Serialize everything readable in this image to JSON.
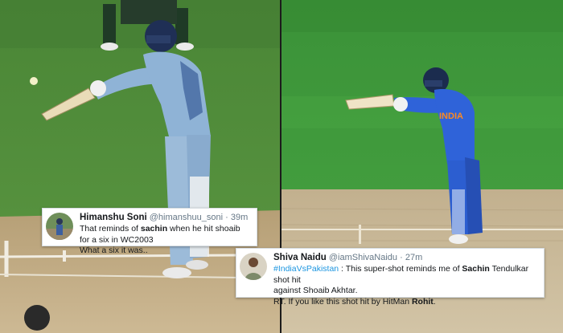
{
  "tweets": [
    {
      "display_name": "Himanshu Soni",
      "handle": "@himanshuu_soni",
      "separator": "·",
      "time": "39m",
      "text_before": "That reminds of ",
      "bold_word": "sachin",
      "text_after": " when he hit shoaib for a six in WC2003",
      "line2": "What a six it was.."
    },
    {
      "display_name": "Shiva Naidu",
      "handle": "@iamShivaNaidu",
      "separator": "·",
      "time": "27m",
      "hashtag": "#IndiaVsPakistan",
      "text_before": " : This super-shot reminds me of ",
      "bold_word": "Sachin",
      "text_after": " Tendulkar shot hit",
      "line2": "against Shoaib Akhtar.",
      "line3_before": "RT. If you like this shot hit by HitMan ",
      "line3_bold": "Rohit",
      "line3_after": "."
    }
  ],
  "photo": {
    "right_jersey_text": "INDIA"
  },
  "colors": {
    "outfield_left": "#4f8a3a",
    "outfield_right": "#3f9a3c",
    "pitch": "#c9b592",
    "jersey_left": "#8fb3d6",
    "jersey_right": "#2f63d9",
    "hashtag": "#1b95e0"
  }
}
